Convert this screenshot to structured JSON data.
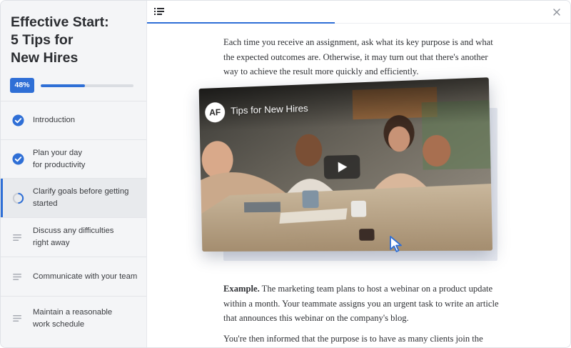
{
  "course": {
    "title": "Effective Start:\n5 Tips for\nNew Hires",
    "progress_label": "48%",
    "progress_fraction": 0.48
  },
  "lessons": [
    {
      "label": "Introduction",
      "status": "completed"
    },
    {
      "label": "Plan your day\nfor productivity",
      "status": "completed"
    },
    {
      "label": "Clarify goals before getting\nstarted",
      "status": "in-progress"
    },
    {
      "label": "Discuss any difficulties\nright away",
      "status": "not-started"
    },
    {
      "label": "Communicate with your team",
      "status": "not-started"
    },
    {
      "label": "Maintain a reasonable\nwork schedule",
      "status": "not-started"
    }
  ],
  "content": {
    "paragraph_1": "Each time you receive an assignment, ask what its key purpose is and what the expected outcomes are. Otherwise, it may turn out that there's another way to achieve the result more quickly and efficiently.",
    "video": {
      "logo": "AF",
      "title": "Tips for New Hires"
    },
    "example_label": "Example.",
    "example_text": " The marketing team plans to host a webinar on a product update within a month. Your teammate assigns you an urgent task to write an article that announces this webinar on the company's blog.",
    "paragraph_3": "You're then informed that the purpose is to have as many clients join the webinar"
  },
  "colors": {
    "accent": "#2f6fd6",
    "sidebar_bg": "#f4f5f7",
    "text": "#2d2f33"
  },
  "icons": {
    "toc": "list-icon",
    "close": "close-icon",
    "completed": "check-circle-icon",
    "in_progress": "progress-ring-icon",
    "not_started": "lines-icon"
  }
}
